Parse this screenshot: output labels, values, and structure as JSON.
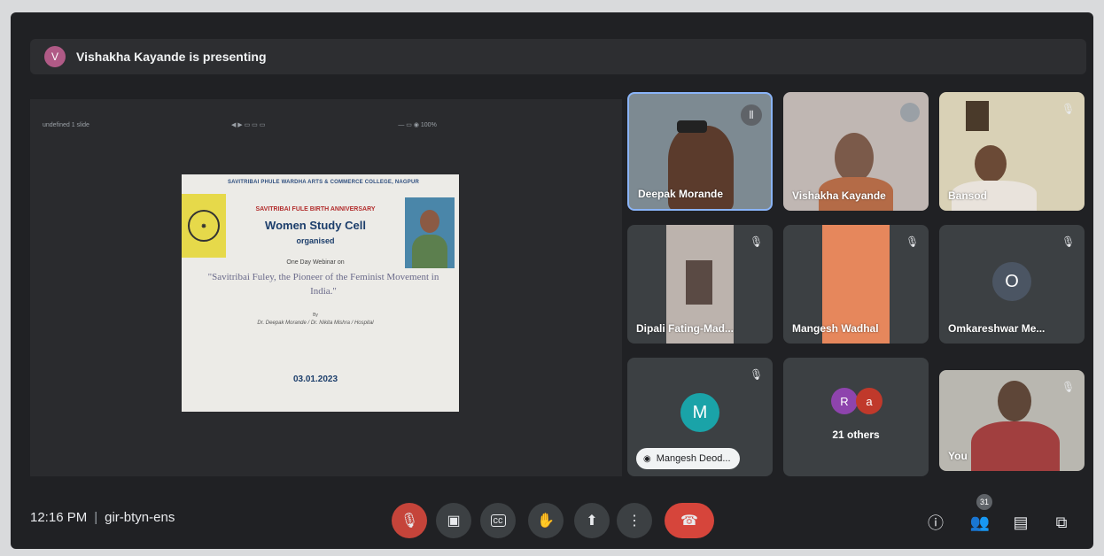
{
  "presenter": {
    "initial": "V",
    "text": "Vishakha Kayande is presenting"
  },
  "toolbar": {
    "left_text": "undefined 1 slide",
    "middle_text": "◀ ▶ ▭ ▭ ▭",
    "right_text": "— ▭ ◉ 100%"
  },
  "slide": {
    "header": "SAVITRIBAI PHULE WARDHA ARTS & COMMERCE COLLEGE, NAGPUR",
    "anniversary": "SAVITRIBAI FULE BIRTH ANNIVERSARY",
    "cell": "Women Study Cell",
    "organised": "organised",
    "webinar": "One Day Webinar on",
    "topic": "\"Savitribai Fuley, the Pioneer of the Feminist Movement in India.\"",
    "by": "By",
    "speakers": "Dr. Deepak Morande / Dr. Nikita Mishra / Hospital",
    "date": "03.01.2023"
  },
  "tiles": [
    {
      "name": "Deepak Morande",
      "kind": "video"
    },
    {
      "name": "Vishakha Kayande",
      "kind": "video"
    },
    {
      "name": "Bansod",
      "kind": "video"
    },
    {
      "name": "Dipali Fating-Mad...",
      "kind": "video"
    },
    {
      "name": "Mangesh Wadhal",
      "kind": "video"
    },
    {
      "name": "Omkareshwar Me...",
      "kind": "avatar",
      "initial": "O"
    },
    {
      "name": "Mangesh Deod...",
      "kind": "avatar",
      "initial": "M"
    },
    {
      "name": "21 others",
      "kind": "group",
      "initials": [
        "R",
        "a"
      ]
    },
    {
      "name": "You",
      "kind": "video"
    }
  ],
  "bottom": {
    "time": "12:16 PM",
    "separator": "|",
    "meeting_code": "gir-btyn-ens",
    "participants_count": "31"
  },
  "colors": {
    "background": "#202124",
    "tile": "#3c4043",
    "accent_blue": "#8ab4f8",
    "red": "#d6453b"
  }
}
